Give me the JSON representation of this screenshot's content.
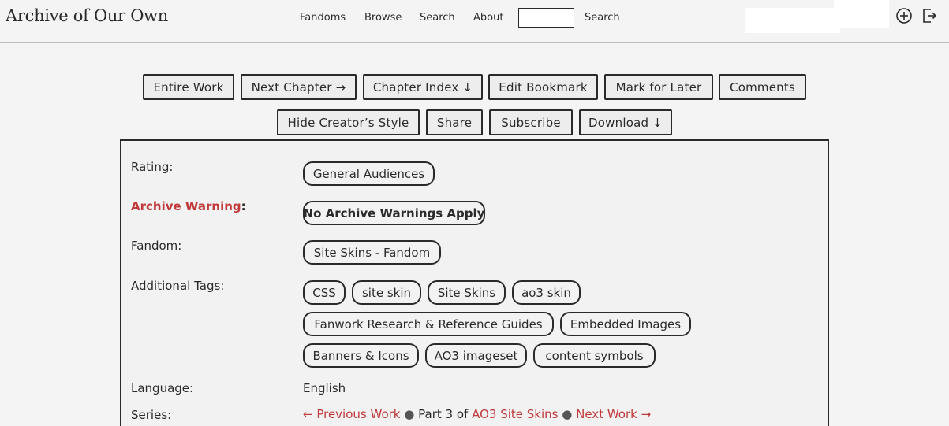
{
  "header": {
    "logo": "Archive of Our Own",
    "nav": [
      "Fandoms",
      "Browse",
      "Search",
      "About"
    ],
    "search_button": "Search",
    "search_value": "",
    "icons": [
      "add-circle-icon",
      "logout-icon"
    ]
  },
  "actions": {
    "row1": [
      "Entire Work",
      "Next Chapter →",
      "Chapter Index ↓",
      "Edit Bookmark",
      "Mark for Later",
      "Comments"
    ],
    "row2": [
      "Hide Creator’s Style",
      "Share",
      "Subscribe",
      "Download ↓"
    ]
  },
  "meta": {
    "rating_label": "Rating:",
    "rating": "General Audiences",
    "warning_label": "Archive Warning",
    "warning_colon": ":",
    "warning": "No Archive Warnings Apply",
    "fandom_label": "Fandom:",
    "fandom": "Site Skins - Fandom",
    "tags_label": "Additional Tags:",
    "tags": [
      "CSS",
      "site skin",
      "Site Skins",
      "ao3 skin",
      "Fanwork Research & Reference Guides",
      "Embedded Images",
      "Banners & Icons",
      "AO3 imageset",
      "content symbols"
    ],
    "language_label": "Language:",
    "language": "English",
    "series_label": "Series:",
    "series": {
      "previous": "← Previous Work",
      "part_text": "Part 3 of",
      "series_name": "AO3 Site Skins",
      "next": "Next Work →",
      "separator": "●"
    }
  },
  "colors": {
    "accent_red": "#c0393b",
    "background": "#f4f4f4",
    "border": "#2a2a2a"
  }
}
